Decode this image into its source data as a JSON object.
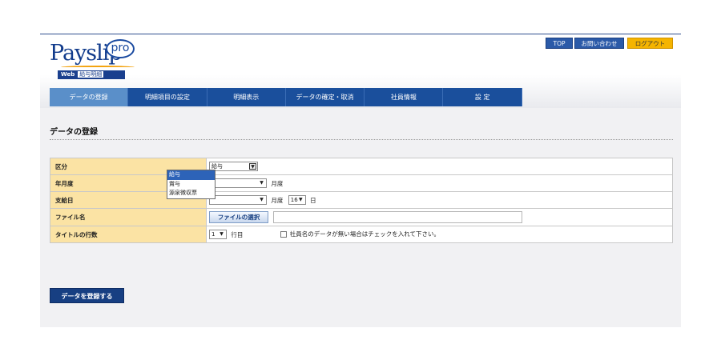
{
  "header": {
    "logo_text": "Payslip",
    "logo_badge": "pro",
    "logo_sub_web": "Web",
    "logo_sub_label": "給与明細",
    "top_label": "TOP",
    "contact_label": "お問い合わせ",
    "logout_label": "ログアウト"
  },
  "nav": {
    "tabs": [
      {
        "label": "データの登録"
      },
      {
        "label": "明細項目の設定"
      },
      {
        "label": "明細表示"
      },
      {
        "label": "データの確定・取消"
      },
      {
        "label": "社員情報"
      },
      {
        "label": "設 定"
      }
    ]
  },
  "page": {
    "title": "データの登録"
  },
  "form": {
    "category": {
      "label": "区分",
      "value": "給与"
    },
    "year_month": {
      "label": "年月度",
      "unit": "月度"
    },
    "pay_date": {
      "label": "支給日",
      "unit_month": "月度",
      "day_value": "16",
      "unit_day": "日"
    },
    "file": {
      "label": "ファイル名",
      "button_label": "ファイルの選択"
    },
    "title_rows": {
      "label": "タイトルの行数",
      "value": "1",
      "unit": "行目",
      "checkbox_label": "社員名のデータが無い場合はチェックを入れて下さい。"
    }
  },
  "dropdown": {
    "options": [
      "給与",
      "賞与",
      "源泉徴収票"
    ],
    "selected": "給与"
  },
  "submit_label": "データを登録する"
}
